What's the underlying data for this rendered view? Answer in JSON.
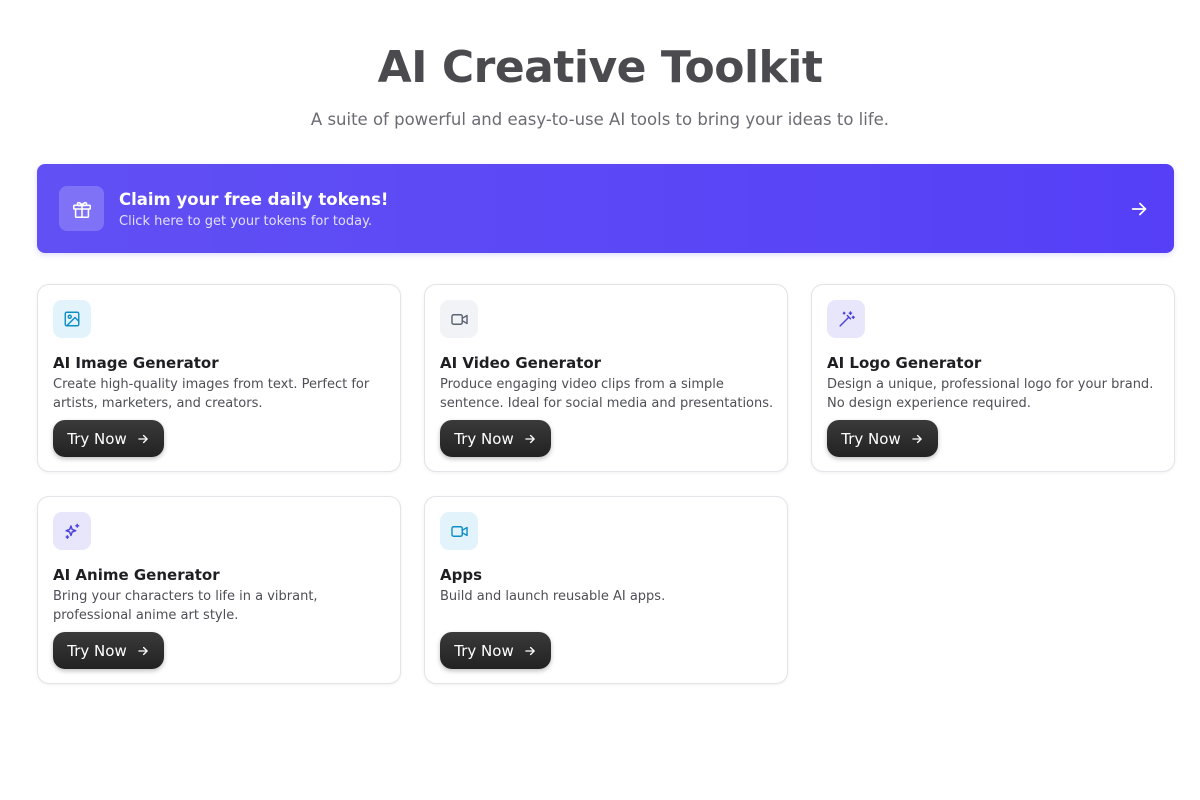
{
  "header": {
    "title": "AI Creative Toolkit",
    "subtitle": "A suite of powerful and easy-to-use AI tools to bring your ideas to life."
  },
  "banner": {
    "icon": "gift-icon",
    "title": "Claim your free daily tokens!",
    "description": "Click here to get your tokens for today.",
    "arrow_icon": "arrow-right-icon",
    "colors": {
      "start": "#6150f4",
      "end": "#563ff7"
    }
  },
  "tools": [
    {
      "icon": "image-icon",
      "title": "AI Image Generator",
      "description": "Create high-quality images from text. Perfect for artists, marketers, and creators.",
      "button": "Try Now",
      "icon_color": "#0e8fc4",
      "icon_bg": "#e3f3fc"
    },
    {
      "icon": "video-icon",
      "title": "AI Video Generator",
      "description": "Produce engaging video clips from a simple sentence. Ideal for social media and presentations.",
      "button": "Try Now",
      "icon_color": "#5b6472",
      "icon_bg": "#f1f3f6"
    },
    {
      "icon": "magic-wand-icon",
      "title": "AI Logo Generator",
      "description": "Design a unique, professional logo for your brand. No design experience required.",
      "button": "Try Now",
      "icon_color": "#4b40d9",
      "icon_bg": "#e7e6fb"
    },
    {
      "icon": "sparkles-icon",
      "title": "AI Anime Generator",
      "description": "Bring your characters to life in a vibrant, professional anime art style.",
      "button": "Try Now",
      "icon_color": "#4b40d9",
      "icon_bg": "#e7e6fb"
    },
    {
      "icon": "video-icon",
      "title": "Apps",
      "description": "Build and launch reusable AI apps.",
      "button": "Try Now",
      "icon_color": "#0e8fc4",
      "icon_bg": "#e3f3fc"
    }
  ]
}
